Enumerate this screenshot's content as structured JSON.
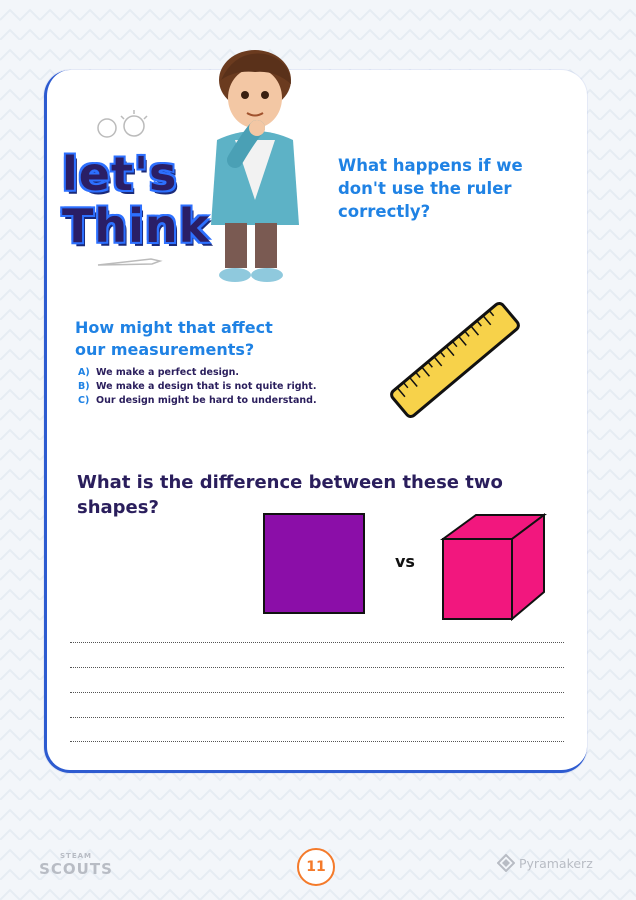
{
  "title": {
    "line1": "let's",
    "line2": "Think"
  },
  "question1": {
    "line1": "What happens if we",
    "line2": "don't use the ruler",
    "line3": "correctly?"
  },
  "question2": {
    "line1": "How might that affect",
    "line2": "our measurements?",
    "options": [
      {
        "letter": "A)",
        "text": "We make a perfect design."
      },
      {
        "letter": "B)",
        "text": "We make a design that is not quite right."
      },
      {
        "letter": "C)",
        "text": "Our design might be hard to understand."
      }
    ]
  },
  "question3": {
    "line1": "What is the difference between these two",
    "line2": "shapes?"
  },
  "shapes": {
    "vs_label": "vs",
    "square_color": "#8b0ea8",
    "cube_color": "#f2177e"
  },
  "footer": {
    "left_logo_top": "STEAM",
    "left_logo_main": "SCOUTS",
    "page_number": "11",
    "right_logo": "Pyramakerz"
  },
  "colors": {
    "accent_blue": "#1f82e4",
    "dark_navy": "#2a1e5c",
    "page_number_orange": "#f47a2a",
    "ruler_yellow": "#f7d24a"
  }
}
